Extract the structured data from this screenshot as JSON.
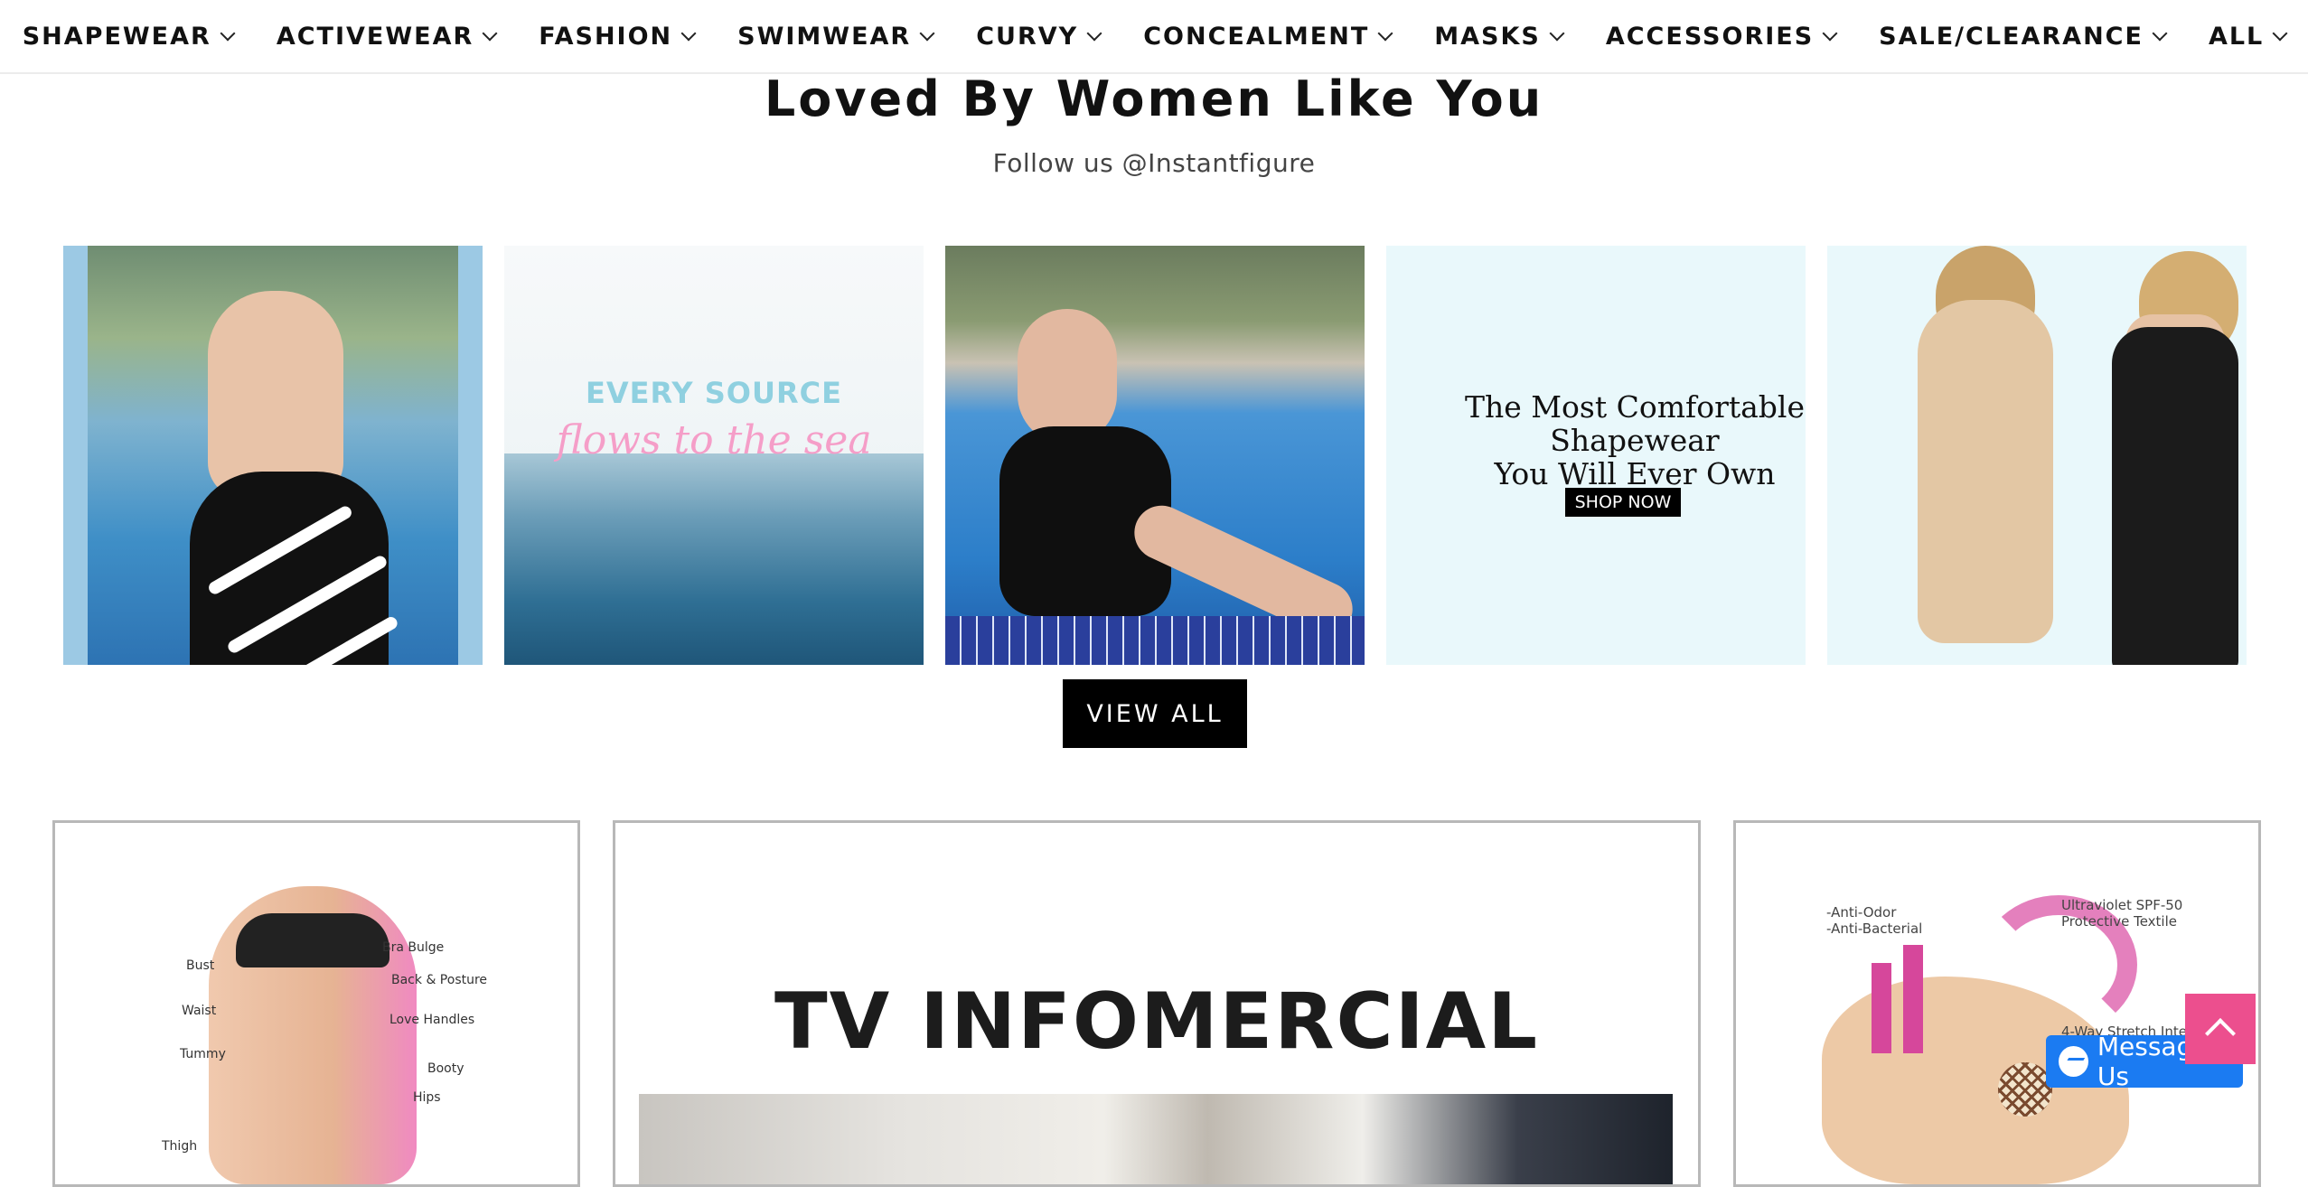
{
  "nav": {
    "items": [
      {
        "label": "SHAPEWEAR"
      },
      {
        "label": "ACTIVEWEAR"
      },
      {
        "label": "FASHION"
      },
      {
        "label": "SWIMWEAR"
      },
      {
        "label": "CURVY"
      },
      {
        "label": "CONCEALMENT"
      },
      {
        "label": "MASKS"
      },
      {
        "label": "ACCESSORIES"
      },
      {
        "label": "SALE/CLEARANCE"
      },
      {
        "label": "ALL"
      }
    ]
  },
  "instagram": {
    "title": "Loved By Women Like You",
    "subtitle": "Follow us @Instantfigure",
    "tile2": {
      "line1": "EVERY SOURCE",
      "line2": "flows to the sea"
    },
    "tile4": {
      "headline": "The Most Comfortable Shapewear\nYou Will Ever Own",
      "cta": "SHOP NOW"
    },
    "view_all": "VIEW ALL"
  },
  "features": {
    "shapewear_labels": [
      "Bust",
      "Waist",
      "Tummy",
      "Thigh",
      "Bra Bulge",
      "Back & Posture",
      "Love Handles",
      "Booty",
      "Hips"
    ],
    "tv_title": "TV INFOMERCIAL",
    "fabric_labels": [
      "-Anti-Odor\n-Anti-Bacterial",
      "Ultraviolet SPF-50\nProtective Textile",
      "4-Way Stretch Interlocking"
    ]
  },
  "widgets": {
    "messenger_label": "Message Us"
  },
  "colors": {
    "accent": "#ec4f8e",
    "messenger": "#1b7bf2",
    "button": "#000000"
  }
}
